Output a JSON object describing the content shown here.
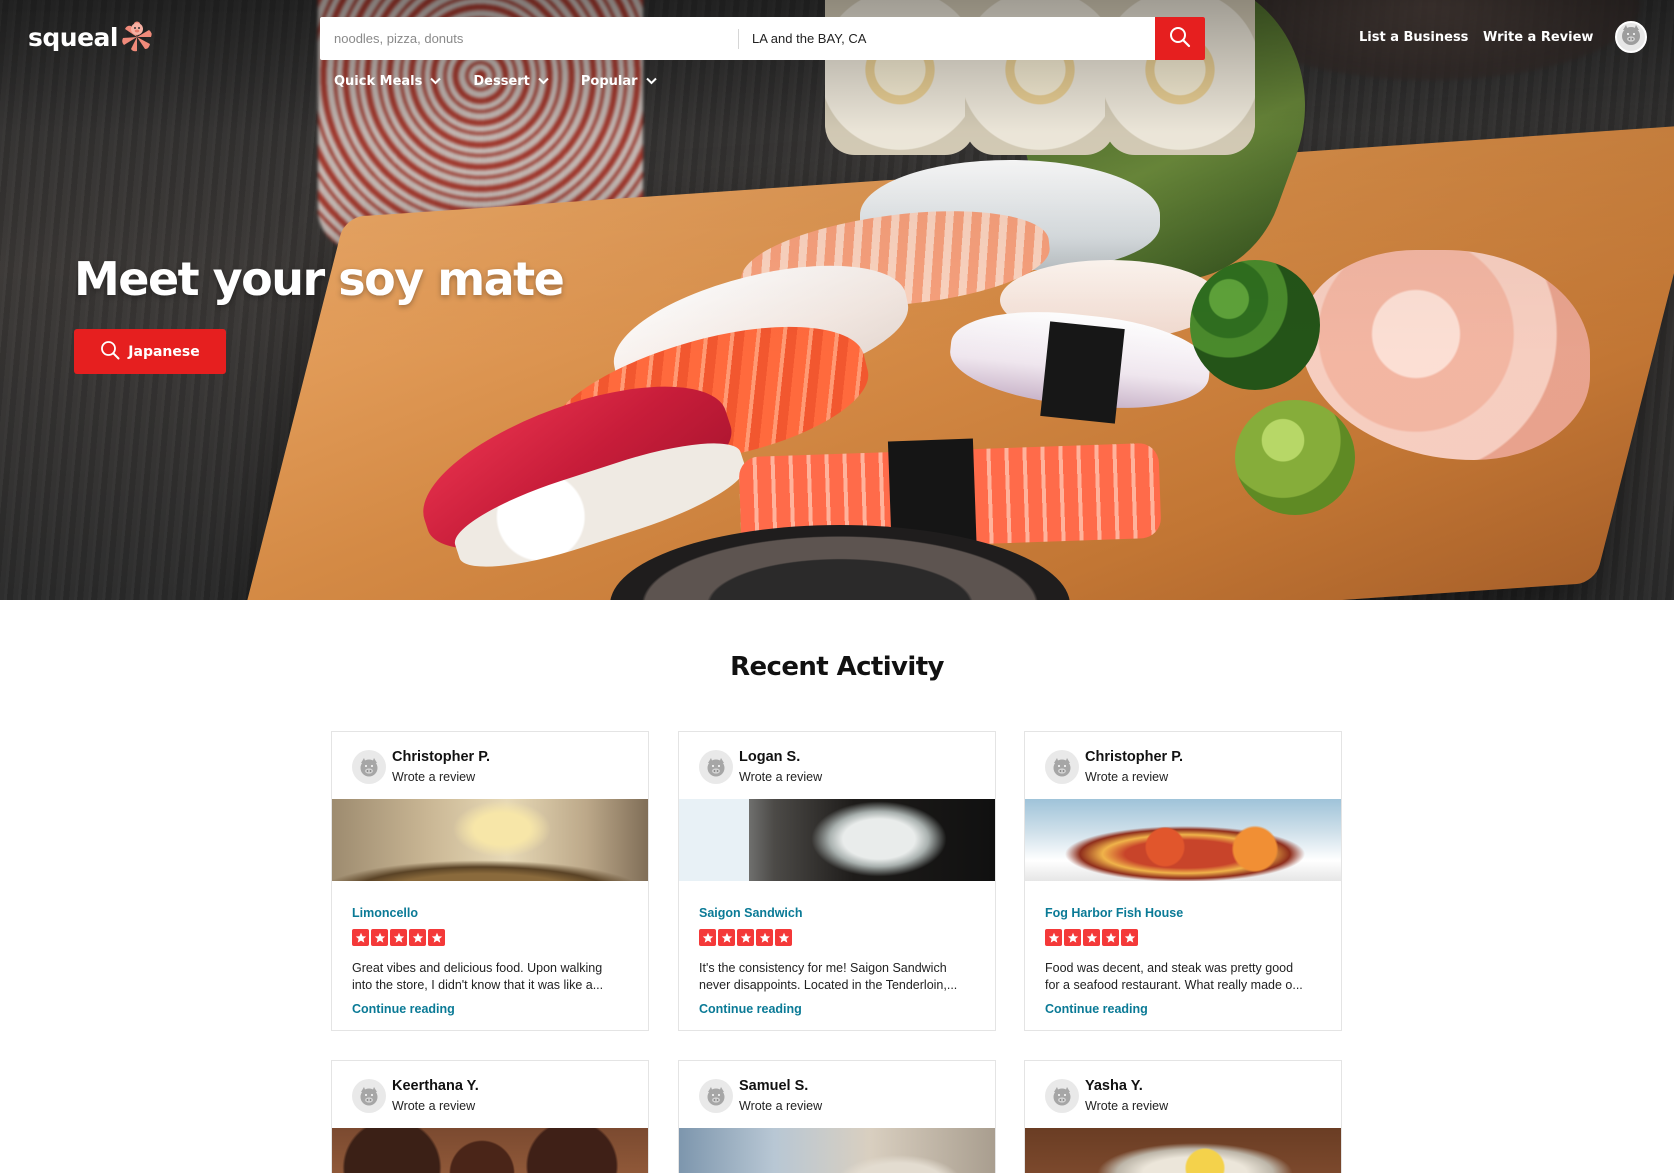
{
  "brand": {
    "name": "squeal",
    "accent_color": "#e61f1f",
    "link_color": "#0a7a96",
    "star_color": "#f43939",
    "logo_mark_color": "#f08a7a"
  },
  "search": {
    "find_placeholder": "noodles, pizza, donuts",
    "near_value": "LA and the BAY, CA",
    "button_icon": "search-icon"
  },
  "header": {
    "list_business": "List a Business",
    "write_review": "Write a Review",
    "avatar_icon": "pig-avatar-icon"
  },
  "subnav": [
    {
      "label": "Quick Meals",
      "icon": "chevron-down-icon"
    },
    {
      "label": "Dessert",
      "icon": "chevron-down-icon"
    },
    {
      "label": "Popular",
      "icon": "chevron-down-icon"
    }
  ],
  "hero": {
    "title": "Meet your soy mate",
    "cta_label": "Japanese",
    "cta_icon": "search-icon"
  },
  "activity": {
    "title": "Recent Activity",
    "cards": [
      {
        "user": "Christopher P.",
        "action": "Wrote a review",
        "business": "Limoncello",
        "rating": 5,
        "excerpt_line1": "Great vibes and delicious food. Upon walking",
        "excerpt_line2": "into the store, I didn't know that it was like a...",
        "more": "Continue reading"
      },
      {
        "user": "Logan S.",
        "action": "Wrote a review",
        "business": "Saigon Sandwich",
        "rating": 5,
        "excerpt_line1": "It's the consistency for me! Saigon Sandwich",
        "excerpt_line2": "never disappoints. Located in the Tenderloin,...",
        "more": "Continue reading"
      },
      {
        "user": "Christopher P.",
        "action": "Wrote a review",
        "business": "Fog Harbor Fish House",
        "rating": 5,
        "excerpt_line1": "Food was decent, and steak was pretty good",
        "excerpt_line2": "for a seafood restaurant. What really made o...",
        "more": "Continue reading"
      },
      {
        "user": "Keerthana Y.",
        "action": "Wrote a review"
      },
      {
        "user": "Samuel S.",
        "action": "Wrote a review"
      },
      {
        "user": "Yasha Y.",
        "action": "Wrote a review"
      }
    ]
  }
}
